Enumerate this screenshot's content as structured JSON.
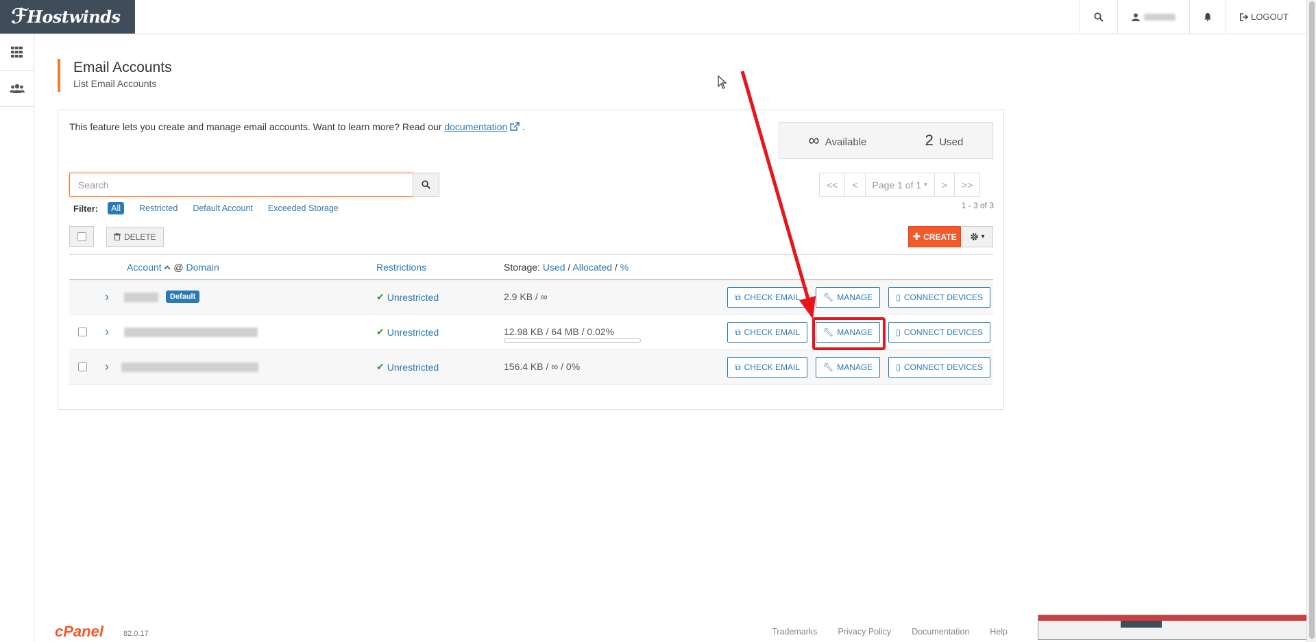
{
  "brand": {
    "name": "Hostwinds"
  },
  "topnav": {
    "user_label": "",
    "logout_label": "LOGOUT"
  },
  "header": {
    "title": "Email Accounts",
    "subtitle": "List Email Accounts"
  },
  "intro": {
    "text": "This feature lets you create and manage email accounts. Want to learn more? Read our",
    "link": "documentation",
    "end": "."
  },
  "stats": {
    "available_value": "∞",
    "available_label": "Available",
    "used_value": "2",
    "used_label": "Used"
  },
  "search": {
    "placeholder": "Search"
  },
  "filters": {
    "label": "Filter:",
    "items": [
      "All",
      "Restricted",
      "Default Account",
      "Exceeded Storage"
    ]
  },
  "pager": {
    "first": "<<",
    "prev": "<",
    "page": "Page 1 of 1",
    "next": ">",
    "last": ">>",
    "range": "1 - 3 of 3"
  },
  "toolbar": {
    "delete_label": "DELETE",
    "create_label": "CREATE"
  },
  "table": {
    "headers": {
      "account": "Account",
      "at": "@",
      "domain": "Domain",
      "restrictions": "Restrictions",
      "storage": "Storage:",
      "used": "Used",
      "allocated": "Allocated",
      "pct": "%"
    },
    "rows": [
      {
        "badge": "Default",
        "restriction": "Unrestricted",
        "storage": "2.9 KB / ∞"
      },
      {
        "restriction": "Unrestricted",
        "storage": "12.98 KB / 64 MB / 0.02%",
        "usage": 0.0002
      },
      {
        "restriction": "Unrestricted",
        "storage": "156.4 KB / ∞ / 0%"
      }
    ],
    "actions": {
      "check": "CHECK EMAIL",
      "manage": "MANAGE",
      "connect": "CONNECT DEVICES"
    }
  },
  "footer": {
    "logo": "cPanel",
    "version": "82.0.17",
    "links": [
      "Trademarks",
      "Privacy Policy",
      "Documentation",
      "Help"
    ]
  },
  "colors": {
    "accent": "#f4592b",
    "link": "#2a7ab8",
    "highlight": "#e8141a"
  }
}
